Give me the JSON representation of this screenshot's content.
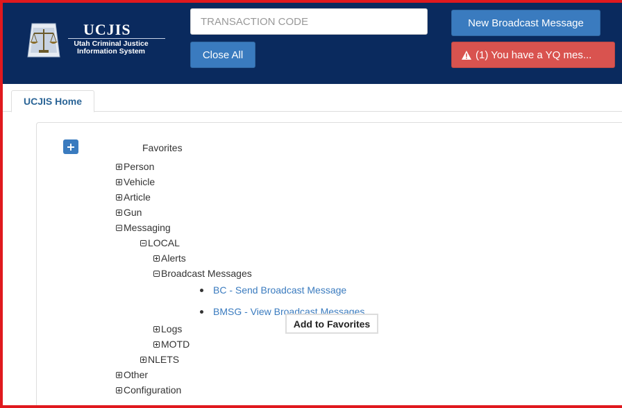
{
  "header": {
    "logo_title": "UCJIS",
    "logo_subtitle_line1": "Utah Criminal Justice",
    "logo_subtitle_line2": "Information System",
    "transaction_placeholder": "TRANSACTION CODE",
    "close_all_label": "Close All",
    "new_broadcast_label": "New Broadcast Message",
    "alert_label": "(1) You have a YQ mes..."
  },
  "tabs": [
    {
      "label": "UCJIS Home",
      "active": true
    }
  ],
  "tree": {
    "root_label": "Favorites",
    "nodes": [
      {
        "label": "Person",
        "expanded": false
      },
      {
        "label": "Vehicle",
        "expanded": false
      },
      {
        "label": "Article",
        "expanded": false
      },
      {
        "label": "Gun",
        "expanded": false
      },
      {
        "label": "Messaging",
        "expanded": true
      },
      {
        "label": "LOCAL",
        "expanded": true
      },
      {
        "label": "Alerts",
        "expanded": false
      },
      {
        "label": "Broadcast Messages",
        "expanded": true
      },
      {
        "label": "Logs",
        "expanded": false
      },
      {
        "label": "MOTD",
        "expanded": false
      },
      {
        "label": "NLETS",
        "expanded": false
      },
      {
        "label": "Other",
        "expanded": false
      },
      {
        "label": "Configuration",
        "expanded": false
      }
    ],
    "links": [
      {
        "label": "BC - Send Broadcast Message"
      },
      {
        "label": "BMSG - View Broadcast Messages"
      }
    ]
  },
  "tooltip": {
    "text": "Add to Favorites"
  },
  "icons": {
    "logo": "scales-of-justice-icon",
    "add": "plus-icon",
    "alert": "warning-triangle-icon",
    "expand": "plus-box-icon",
    "collapse": "minus-box-icon"
  },
  "colors": {
    "header_bg": "#0a2a5e",
    "primary_button": "#3a7bbf",
    "danger_button": "#d9534f",
    "highlight_border": "#e0191e",
    "link": "#3a7bbf"
  }
}
